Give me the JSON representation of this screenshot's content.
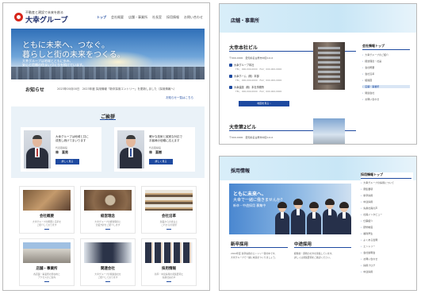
{
  "main": {
    "logo_tag": "不動産と建設で未来を創る",
    "logo_name": "大幸グループ",
    "nav": [
      "トップ",
      "会社概要",
      "店舗・事業所",
      "社長室",
      "採用情報",
      "お問い合わせ"
    ],
    "hero_line1": "ともに未来へ、つなぐ。",
    "hero_line2": "暮らしと街の未来をつくる。",
    "hero_sub1": "大幸グループは地域とともに歩み、",
    "hero_sub2": "安心と信頼の住まいづくりを続けています。",
    "news_title": "お知らせ",
    "news_item": "2023年00月00日　2023年度 採用情報「新卒採用エントリー」を更新しました（採用情報へ）",
    "news_more": "お知らせ一覧はこちら",
    "greet_title": "ご挨拶",
    "cards": [
      {
        "line1": "大幸グループは地域と共に",
        "line2": "成長し続けてまいります",
        "role": "代表取締役",
        "name": "林　直男",
        "button": "詳しく見る"
      },
      {
        "line1": "確かな技術と誠実な対応で",
        "line2": "お客様の信頼に応えます",
        "role": "代表取締役",
        "name": "林　直樹",
        "button": "詳しく見る"
      }
    ],
    "tiles": [
      {
        "title": "会社概要",
        "desc1": "大幸グループの概要と沿革を",
        "desc2": "ご紹介しております"
      },
      {
        "title": "経営理念",
        "desc1": "大幸グループの経営理念と",
        "desc2": "企業方針をご紹介します"
      },
      {
        "title": "会社沿革",
        "desc1": "創業からの歩みと",
        "desc2": "これからの展望"
      },
      {
        "title": "店舗・事業所",
        "desc1": "各店舗・事業所の所在地と",
        "desc2": "アクセスのご案内"
      },
      {
        "title": "関連会社",
        "desc1": "大幸グループの関連会社を",
        "desc2": "ご紹介しております"
      },
      {
        "title": "採用情報",
        "desc1": "新卒・中途採用の募集要項と",
        "desc2": "先輩社員の声"
      }
    ]
  },
  "office": {
    "page_title": "店舗・事業所",
    "section1_title": "大幸本社ビル",
    "section1_addr": "〒000-0000　愛知県名古屋市中区0-0-0",
    "items": [
      {
        "label": "大幸グループ本社",
        "tel": "TEL：000-000-0000　FAX：000-000-0000"
      },
      {
        "label": "大幸ホーム（株）本部",
        "tel": "TEL：000-000-0000　FAX：000-000-0000"
      },
      {
        "label": "大幸建設（株）本社事務所",
        "tel": "TEL：000-000-0000　FAX：000-000-0000"
      }
    ],
    "map_button": "地図を見る ›",
    "section2_title": "大幸第2ビル",
    "section2_addr": "〒000-0000　愛知県名古屋市中区0-0-0",
    "sidebar_title": "会社情報トップ",
    "sidebar_items": [
      "大幸グループのご紹介",
      "経営理念・社是",
      "会社概要",
      "会社沿革",
      "組織図",
      "店舗・事業所",
      "関連会社",
      "お問い合わせ"
    ],
    "sidebar_active": 5
  },
  "recruit": {
    "page_title": "採用情報",
    "banner_line1": "ともに未来へ、",
    "banner_line2": "大幸で一緒に働きませんか？",
    "banner_line3": "新卒・中途採用 募集中",
    "sec1_title": "新卒採用",
    "sec1_txt1": "2024年度 新卒採用のエントリー受付中です。",
    "sec1_txt2": "大幸グループで一緒に未来をつくりましょう。",
    "sec2_title": "中途採用",
    "sec2_txt1": "経験者・即戦力の方を募集しています。",
    "sec2_txt2": "詳しくは募集要項をご確認ください。",
    "sidebar_title": "採用情報トップ",
    "sidebar_items": [
      "大幸グループの採用について",
      "募集要項",
      "新卒採用",
      "中途採用",
      "先輩社員の声",
      "社員インタビュー",
      "仕事紹介",
      "研修制度",
      "福利厚生",
      "よくある質問",
      "エントリー",
      "会社説明会",
      "お問い合わせ",
      "採用ブログ",
      "中途採用"
    ]
  }
}
